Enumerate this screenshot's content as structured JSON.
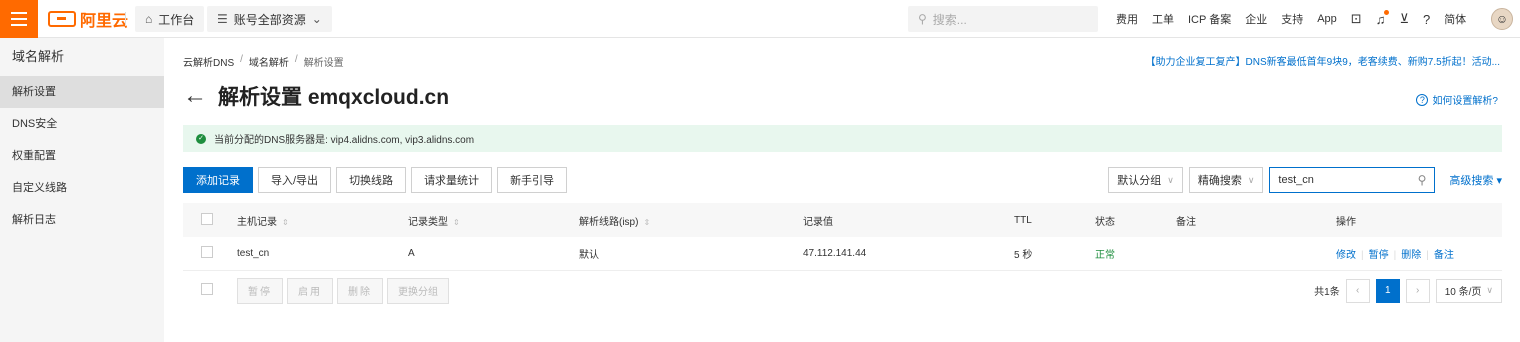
{
  "topbar": {
    "logo_text": "阿里云",
    "workbench": "工作台",
    "resources": "账号全部资源",
    "search_placeholder": "搜索...",
    "links": [
      "费用",
      "工单",
      "ICP 备案",
      "企业",
      "支持",
      "App"
    ],
    "lang": "简体",
    "brand_color": "#ff6a00"
  },
  "sidebar": {
    "title": "域名解析",
    "items": [
      {
        "label": "解析设置"
      },
      {
        "label": "DNS安全"
      },
      {
        "label": "权重配置"
      },
      {
        "label": "自定义线路"
      },
      {
        "label": "解析日志"
      }
    ]
  },
  "breadcrumb": [
    "云解析DNS",
    "域名解析",
    "解析设置"
  ],
  "promo": "【助力企业复工复产】DNS新客最低首年9块9，老客续费、新购7.5折起！活动...",
  "page": {
    "title": "解析设置 emqxcloud.cn",
    "help": "如何设置解析?",
    "notice": "当前分配的DNS服务器是: vip4.alidns.com, vip3.alidns.com"
  },
  "toolbar": {
    "add": "添加记录",
    "import": "导入/导出",
    "switch": "切换线路",
    "stats": "请求量统计",
    "guide": "新手引导",
    "group": "默认分组",
    "search_mode": "精确搜索",
    "search_value": "test_cn",
    "advanced": "高级搜索"
  },
  "table": {
    "headers": [
      "主机记录",
      "记录类型",
      "解析线路(isp)",
      "记录值",
      "TTL",
      "状态",
      "备注",
      "操作"
    ],
    "rows": [
      {
        "host": "test_cn",
        "type": "A",
        "line": "默认",
        "value": "47.112.141.44",
        "ttl": "5 秒",
        "status": "正常",
        "remark": "",
        "ops": [
          "修改",
          "暂停",
          "删除",
          "备注"
        ]
      }
    ]
  },
  "footer": {
    "buttons": [
      "暂停",
      "启用",
      "删除",
      "更换分组"
    ],
    "total": "共1条",
    "page": "1",
    "page_size": "10 条/页"
  }
}
